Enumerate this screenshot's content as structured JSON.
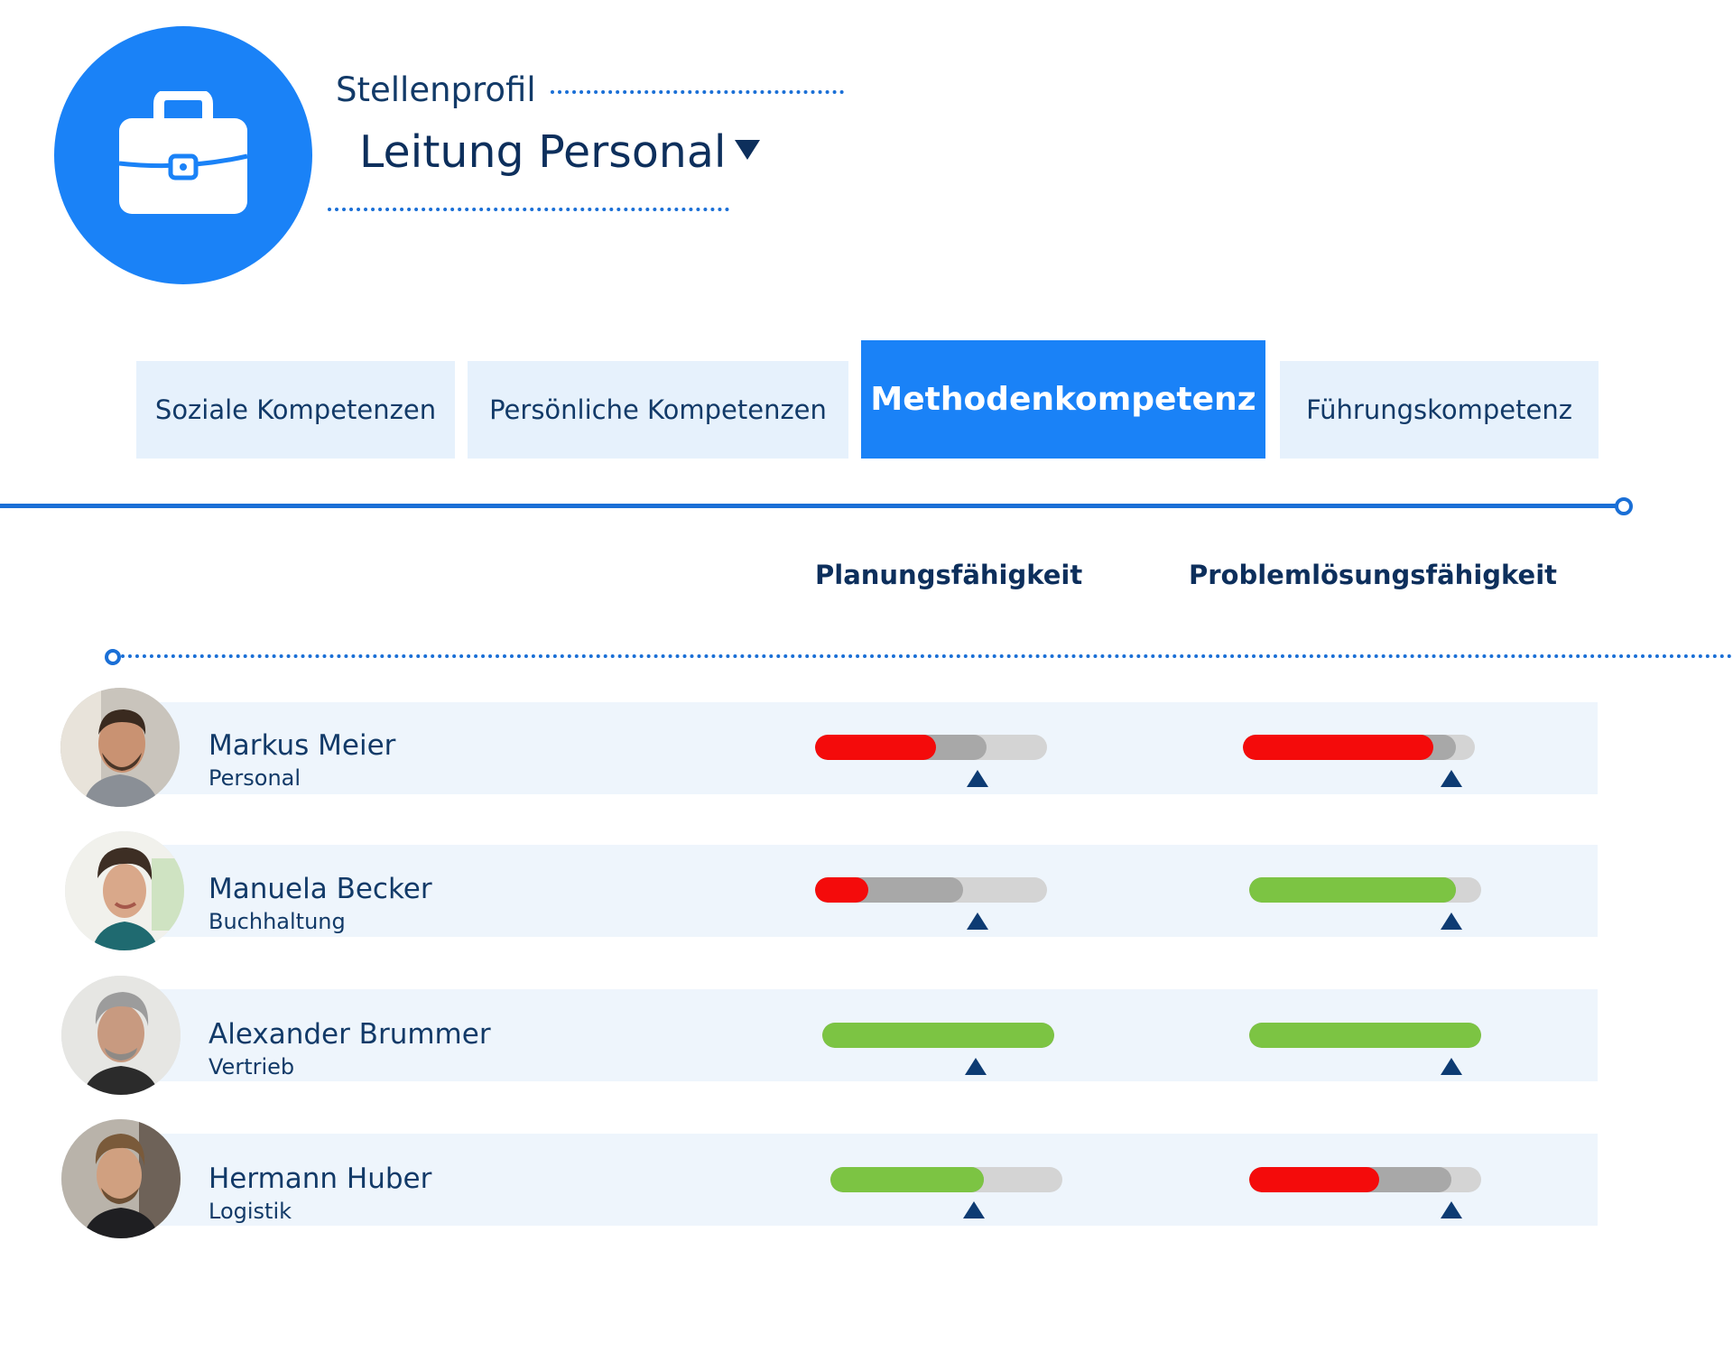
{
  "header": {
    "profile_label": "Stellenprofil",
    "profile_value": "Leitung Personal",
    "icon": "briefcase-icon",
    "accent_color": "#1a82f7"
  },
  "tabs": [
    {
      "label": "Soziale Kompetenzen",
      "active": false
    },
    {
      "label": "Persönliche Kompetenzen",
      "active": false
    },
    {
      "label": "Methodenkompetenz",
      "active": true
    },
    {
      "label": "Führungskompetenz",
      "active": false
    }
  ],
  "columns": [
    "Planungsfähigkeit",
    "Problemlösungsfähigkeit"
  ],
  "legend_colors": {
    "below": "#f40b0b",
    "meets": "#7cc443",
    "target_marker": "#0d3b73"
  },
  "employees": [
    {
      "name": "Markus Meier",
      "department": "Personal",
      "scores": [
        {
          "value": 0.52,
          "gray": 0.74,
          "color": "#f40b0b",
          "target": 0.7
        },
        {
          "value": 0.82,
          "gray": 0.92,
          "color": "#f40b0b",
          "target": 0.9
        }
      ]
    },
    {
      "name": "Manuela Becker",
      "department": "Buchhaltung",
      "scores": [
        {
          "value": 0.23,
          "gray": 0.64,
          "color": "#f40b0b",
          "target": 0.7
        },
        {
          "value": 0.89,
          "gray": 0.89,
          "color": "#7cc443",
          "target": 0.87
        }
      ]
    },
    {
      "name": "Alexander Brummer",
      "department": "Vertrieb",
      "scores": [
        {
          "value": 1.0,
          "gray": 1.0,
          "color": "#7cc443",
          "target": 0.66
        },
        {
          "value": 1.0,
          "gray": 1.0,
          "color": "#7cc443",
          "target": 0.87
        }
      ]
    },
    {
      "name": "Hermann Huber",
      "department": "Logistik",
      "scores": [
        {
          "value": 0.66,
          "gray": 0.66,
          "color": "#7cc443",
          "target": 0.62
        },
        {
          "value": 0.56,
          "gray": 0.87,
          "color": "#f40b0b",
          "target": 0.87
        }
      ]
    }
  ]
}
